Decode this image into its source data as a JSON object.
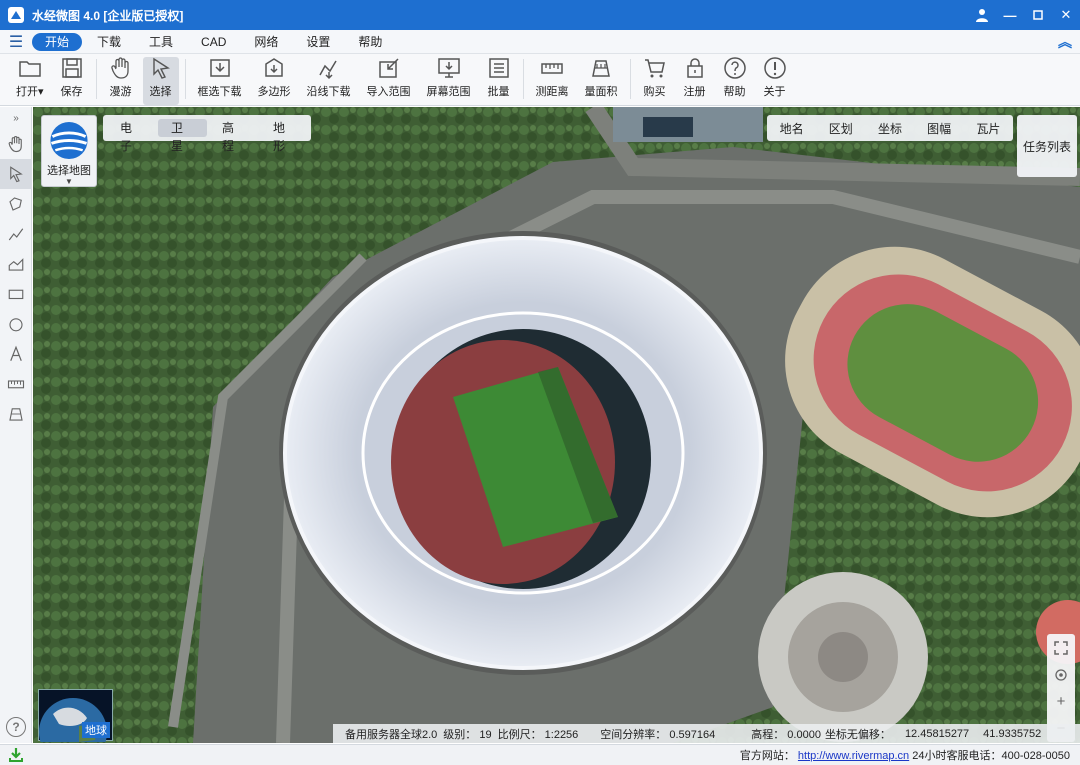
{
  "window": {
    "title": "水经微图 4.0 [企业版已授权]"
  },
  "menu": {
    "items": [
      "开始",
      "下载",
      "工具",
      "CAD",
      "网络",
      "设置",
      "帮助"
    ],
    "active": "开始"
  },
  "toolbar": {
    "tools": [
      {
        "label": "打开▾",
        "icon": "folder-icon"
      },
      {
        "label": "保存",
        "icon": "save-icon"
      },
      {
        "label": "漫游",
        "icon": "hand-icon"
      },
      {
        "label": "选择",
        "icon": "cursor-icon",
        "selected": true
      },
      {
        "label": "框选下载",
        "icon": "box-download-icon"
      },
      {
        "label": "多边形",
        "icon": "polygon-icon"
      },
      {
        "label": "沿线下载",
        "icon": "line-download-icon"
      },
      {
        "label": "导入范围",
        "icon": "import-icon"
      },
      {
        "label": "屏幕范围",
        "icon": "screen-icon"
      },
      {
        "label": "批量",
        "icon": "batch-icon"
      },
      {
        "label": "测距离",
        "icon": "ruler-icon"
      },
      {
        "label": "量面积",
        "icon": "area-icon"
      },
      {
        "label": "购买",
        "icon": "cart-icon"
      },
      {
        "label": "注册",
        "icon": "lock-icon"
      },
      {
        "label": "帮助",
        "icon": "help-icon"
      },
      {
        "label": "关于",
        "icon": "info-icon"
      }
    ]
  },
  "map": {
    "select_map_label": "选择地图",
    "map_types": [
      "电子",
      "卫星",
      "高程",
      "地形"
    ],
    "active_map_type": "卫星",
    "layers": [
      "地名",
      "区划",
      "坐标",
      "图幅",
      "瓦片"
    ],
    "task_list": "任务列表",
    "globe_label": "地球",
    "info": {
      "server": "备用服务器全球2.0",
      "level": "级别：  19",
      "scale": "比例尺：  1:2256",
      "resolution": "空间分辨率：  0.597164",
      "elevation": "高程：     0.0000",
      "coords_mode": "坐标无偏移：",
      "lon": "12.45815277",
      "lat": "41.9335752"
    }
  },
  "statusbar": {
    "site_label": "官方网站：",
    "site_url": "http://www.rivermap.cn",
    "hotline": "24小时客服电话：400-028-0050"
  }
}
